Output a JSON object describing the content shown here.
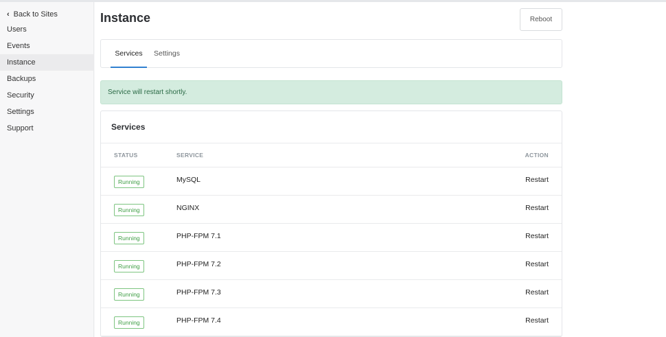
{
  "sidebar": {
    "back_label": "Back to Sites",
    "items": [
      {
        "label": "Users",
        "active": false
      },
      {
        "label": "Events",
        "active": false
      },
      {
        "label": "Instance",
        "active": true
      },
      {
        "label": "Backups",
        "active": false
      },
      {
        "label": "Security",
        "active": false
      },
      {
        "label": "Settings",
        "active": false
      },
      {
        "label": "Support",
        "active": false
      }
    ]
  },
  "header": {
    "title": "Instance",
    "reboot_label": "Reboot"
  },
  "tabs": [
    {
      "label": "Services",
      "active": true
    },
    {
      "label": "Settings",
      "active": false
    }
  ],
  "alert": {
    "message": "Service will restart shortly.",
    "color": "#d4ecdf"
  },
  "services_table": {
    "title": "Services",
    "columns": {
      "status": "STATUS",
      "service": "SERVICE",
      "action": "ACTION"
    },
    "rows": [
      {
        "status": "Running",
        "service": "MySQL",
        "action": "Restart"
      },
      {
        "status": "Running",
        "service": "NGINX",
        "action": "Restart"
      },
      {
        "status": "Running",
        "service": "PHP-FPM 7.1",
        "action": "Restart"
      },
      {
        "status": "Running",
        "service": "PHP-FPM 7.2",
        "action": "Restart"
      },
      {
        "status": "Running",
        "service": "PHP-FPM 7.3",
        "action": "Restart"
      },
      {
        "status": "Running",
        "service": "PHP-FPM 7.4",
        "action": "Restart"
      }
    ]
  },
  "colors": {
    "accent": "#2f80d0",
    "running_status": "#3f9e45"
  }
}
